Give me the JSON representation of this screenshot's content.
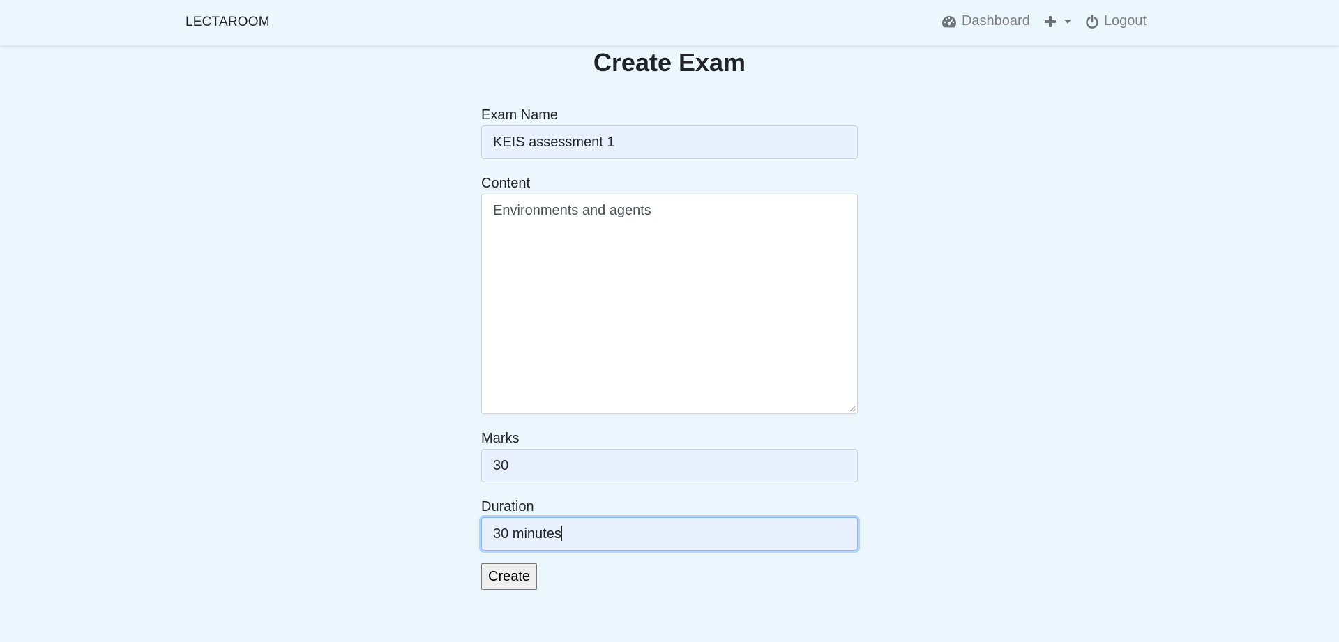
{
  "navbar": {
    "brand": "LECTAROOM",
    "dashboard_label": "Dashboard",
    "logout_label": "Logout",
    "icons": {
      "dashboard": "tachometer-icon",
      "add": "plus-icon",
      "add_dropdown": "caret-down-icon",
      "logout": "power-icon"
    }
  },
  "page": {
    "title": "Create Exam"
  },
  "form": {
    "exam_name": {
      "label": "Exam Name",
      "value": "KEIS assessment 1"
    },
    "content": {
      "label": "Content",
      "value": "Environments and agents"
    },
    "marks": {
      "label": "Marks",
      "value": "30"
    },
    "duration": {
      "label": "Duration",
      "value": "30 minutes"
    },
    "submit_label": "Create"
  },
  "colors": {
    "page_background": "#ecf6fd",
    "autofill_background": "#e8f0fe",
    "focus_ring": "#86b7fe",
    "nav_text": "#7a7f84"
  }
}
